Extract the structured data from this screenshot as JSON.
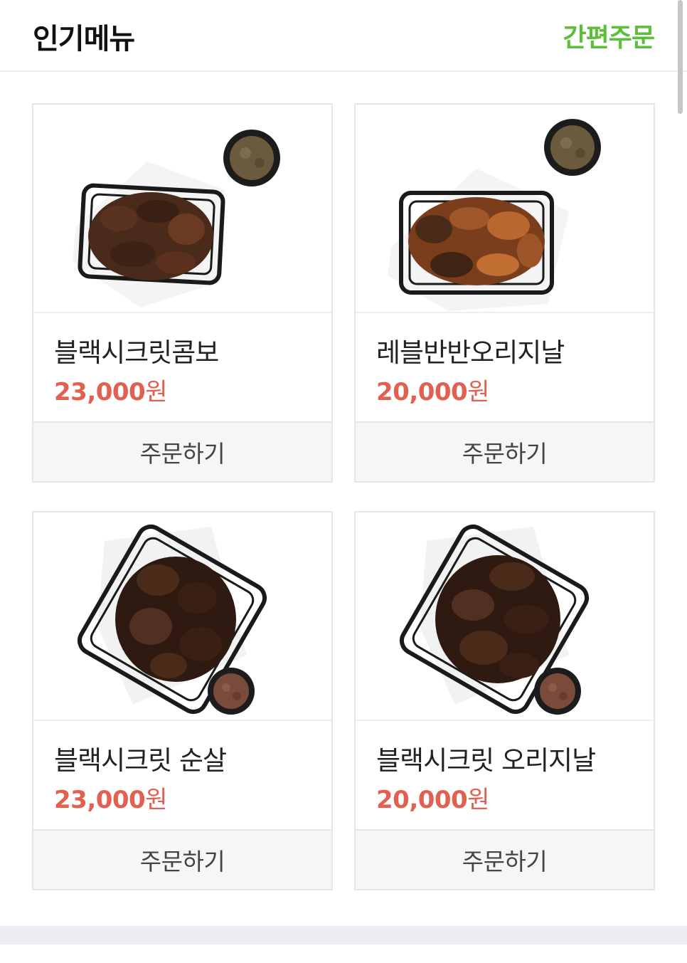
{
  "header": {
    "title": "인기메뉴",
    "quick_order": "간편주문"
  },
  "menu_items": [
    {
      "name": "블랙시크릿콤보",
      "price": "23,000",
      "currency": "원",
      "order_label": "주문하기",
      "image": "chicken-basket-with-sauce-icon"
    },
    {
      "name": "레블반반오리지날",
      "price": "20,000",
      "currency": "원",
      "order_label": "주문하기",
      "image": "chicken-basket-with-sauce-icon"
    },
    {
      "name": "블랙시크릿 순살",
      "price": "23,000",
      "currency": "원",
      "order_label": "주문하기",
      "image": "chicken-basket-with-sauce-icon"
    },
    {
      "name": "블랙시크릿 오리지날",
      "price": "20,000",
      "currency": "원",
      "order_label": "주문하기",
      "image": "chicken-basket-with-sauce-icon"
    }
  ],
  "colors": {
    "accent_green": "#5bbf3a",
    "price_red": "#e2604f"
  }
}
